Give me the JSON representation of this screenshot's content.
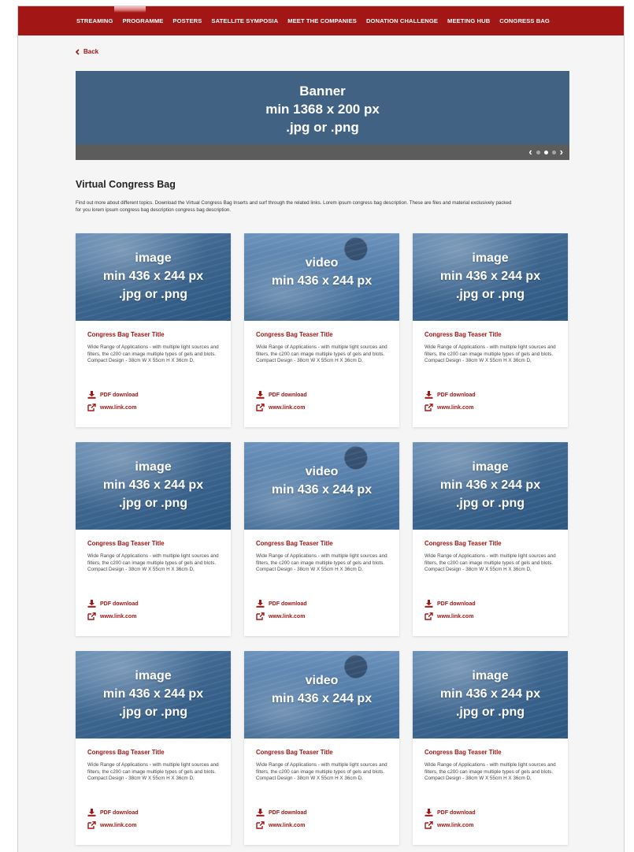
{
  "nav": {
    "items": [
      "STREAMING",
      "PROGRAMME",
      "POSTERS",
      "SATELLITE SYMPOSIA",
      "MEET THE COMPANIES",
      "DONATION CHALLENGE",
      "MEETING HUB",
      "CONGRESS BAG"
    ]
  },
  "back_label": "Back",
  "banner": {
    "line1": "Banner",
    "line2": "min 1368 x 200 px",
    "line3": ".jpg or .png",
    "slides": 3,
    "active_slide": 2
  },
  "section": {
    "title": "Virtual Congress Bag",
    "description": "Find out more about different topics. Download the Virtual Congress Bag Inserts and surf through the related links. Lorem ipsum congress bag description. These are files and material exclusively packed for you lorem ipsum congress bag description congress bag description."
  },
  "cards": [
    {
      "media_type": "image",
      "line1": "image",
      "line2": "min 436 x 244 px",
      "line3": ".jpg or .png",
      "title": "Congress Bag Teaser Title",
      "body": "Wide Range of Applications - with multiple light sources and filters, the c200 can image multiple types of gels and blots. Compact Design - 38cm W X 55cm H X 36cm D,",
      "pdf_label": "PDF download",
      "link_label": "www.link.com"
    },
    {
      "media_type": "video",
      "line1": "video",
      "line2": "min 436 x 244 px",
      "line3": "",
      "title": "Congress Bag Teaser Title",
      "body": "Wide Range of Applications - with multiple light sources and filters, the c200 can image multiple types of gels and blots. Compact Design - 38cm W X 55cm H X 36cm D,",
      "pdf_label": "PDF download",
      "link_label": "www.link.com"
    },
    {
      "media_type": "image",
      "line1": "image",
      "line2": "min 436 x 244 px",
      "line3": ".jpg or .png",
      "title": "Congress Bag Teaser Title",
      "body": "Wide Range of Applications - with multiple light sources and filters, the c200 can image multiple types of gels and blots. Compact Design - 38cm W X 55cm H X 36cm D,",
      "pdf_label": "PDF download",
      "link_label": "www.link.com"
    },
    {
      "media_type": "image",
      "line1": "image",
      "line2": "min 436 x 244 px",
      "line3": ".jpg or .png",
      "title": "Congress Bag Teaser Title",
      "body": "Wide Range of Applications - with multiple light sources and filters, the c200 can image multiple types of gels and blots. Compact Design - 38cm W X 55cm H X 36cm D,",
      "pdf_label": "PDF download",
      "link_label": "www.link.com"
    },
    {
      "media_type": "video",
      "line1": "video",
      "line2": "min 436 x 244 px",
      "line3": "",
      "title": "Congress Bag Teaser Title",
      "body": "Wide Range of Applications - with multiple light sources and filters, the c200 can image multiple types of gels and blots. Compact Design - 38cm W X 55cm H X 36cm D,",
      "pdf_label": "PDF download",
      "link_label": "www.link.com"
    },
    {
      "media_type": "image",
      "line1": "image",
      "line2": "min 436 x 244 px",
      "line3": ".jpg or .png",
      "title": "Congress Bag Teaser Title",
      "body": "Wide Range of Applications - with multiple light sources and filters, the c200 can image multiple types of gels and blots. Compact Design - 38cm W X 55cm H X 36cm D,",
      "pdf_label": "PDF download",
      "link_label": "www.link.com"
    },
    {
      "media_type": "image",
      "line1": "image",
      "line2": "min 436 x 244 px",
      "line3": ".jpg or .png",
      "title": "Congress Bag Teaser Title",
      "body": "Wide Range of Applications - with multiple light sources and filters, the c200 can image multiple types of gels and blots. Compact Design - 38cm W X 55cm H X 36cm D,",
      "pdf_label": "PDF download",
      "link_label": "www.link.com"
    },
    {
      "media_type": "video",
      "line1": "video",
      "line2": "min 436 x 244 px",
      "line3": "",
      "title": "Congress Bag Teaser Title",
      "body": "Wide Range of Applications - with multiple light sources and filters, the c200 can image multiple types of gels and blots. Compact Design - 38cm W X 55cm H X 36cm D,",
      "pdf_label": "PDF download",
      "link_label": "www.link.com"
    },
    {
      "media_type": "image",
      "line1": "image",
      "line2": "min 436 x 244 px",
      "line3": ".jpg or .png",
      "title": "Congress Bag Teaser Title",
      "body": "Wide Range of Applications - with multiple light sources and filters, the c200 can image multiple types of gels and blots. Compact Design - 38cm W X 55cm H X 36cm D,",
      "pdf_label": "PDF download",
      "link_label": "www.link.com"
    }
  ],
  "colors": {
    "brand_red": "#a31616",
    "banner_blue": "#416283",
    "banner_bar": "#5c5c5c",
    "page_bg": "#f5f5f5"
  },
  "icons": {
    "back": "chevron-left-icon",
    "pdf": "download-icon",
    "link": "external-link-icon",
    "carousel_prev": "chevron-left-icon",
    "carousel_next": "chevron-right-icon"
  }
}
